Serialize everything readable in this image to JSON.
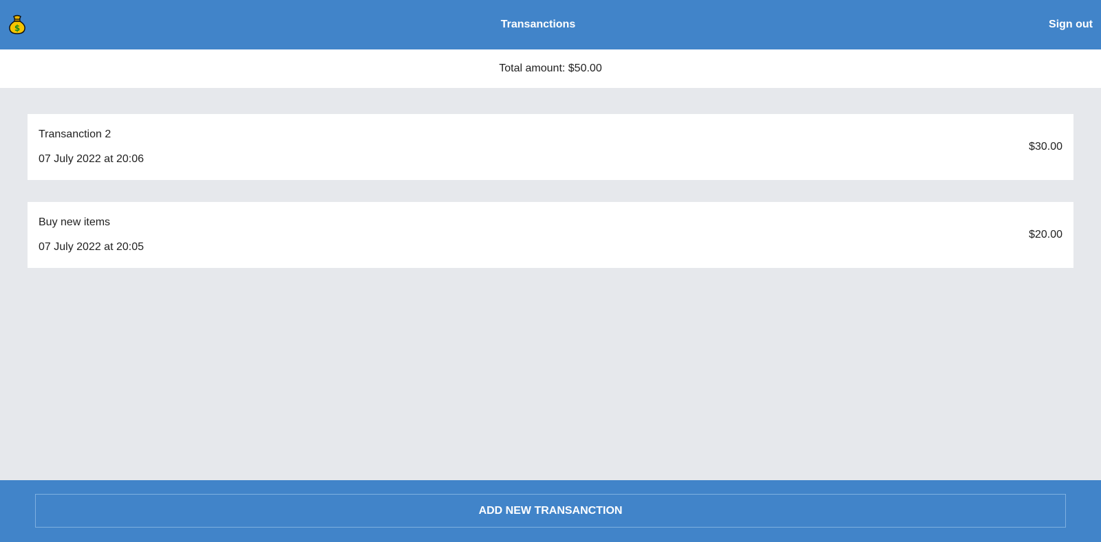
{
  "header": {
    "logo_icon": "money-bag-icon",
    "title": "Transanctions",
    "sign_out_label": "Sign out"
  },
  "summary": {
    "total_text": "Total amount: $50.00"
  },
  "transactions": [
    {
      "name": "Transanction 2",
      "date": "07 July 2022 at 20:06",
      "amount": "$30.00"
    },
    {
      "name": "Buy new items",
      "date": "07 July 2022 at 20:05",
      "amount": "$20.00"
    }
  ],
  "footer": {
    "add_button_label": "ADD NEW TRANSANCTION"
  },
  "colors": {
    "primary": "#4184c9",
    "background": "#e6e8ec",
    "card": "#ffffff",
    "text": "#1f1f1f"
  }
}
